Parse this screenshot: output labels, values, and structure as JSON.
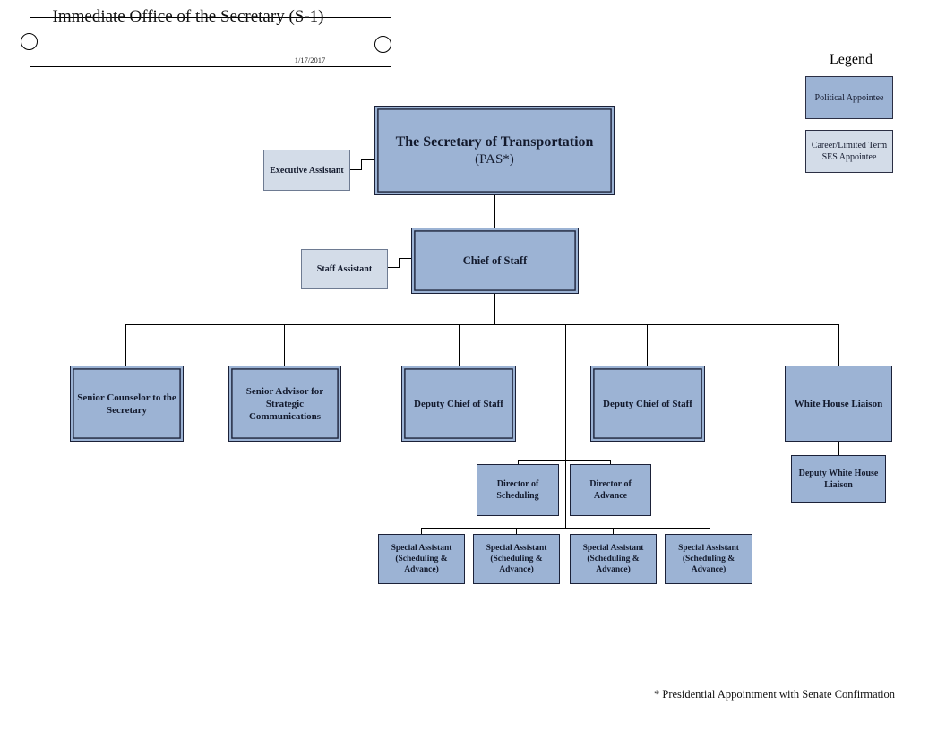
{
  "header": {
    "title": "Immediate Office of the Secretary (S-1)",
    "date": "1/17/2017"
  },
  "legend": {
    "title": "Legend",
    "items": [
      {
        "label": "Political Appointee",
        "color": "#9cb3d4",
        "type": "political"
      },
      {
        "label": "Career/Limited Term SES Appointee",
        "color": "#d3dce8",
        "type": "career"
      }
    ]
  },
  "nodes": {
    "secretary": {
      "title": "The Secretary of Transportation",
      "subtitle": "(PAS*)"
    },
    "executive_assistant": {
      "title": "Executive Assistant"
    },
    "chief_of_staff": {
      "title": "Chief of Staff"
    },
    "staff_assistant": {
      "title": "Staff Assistant"
    },
    "senior_counselor": {
      "title": "Senior Counselor to the Secretary"
    },
    "senior_advisor": {
      "title": "Senior Advisor for Strategic Communications"
    },
    "deputy_chief_1": {
      "title": "Deputy Chief of Staff"
    },
    "deputy_chief_2": {
      "title": "Deputy Chief of Staff"
    },
    "white_house_liaison": {
      "title": "White House Liaison"
    },
    "deputy_white_house_liaison": {
      "title": "Deputy White House Liaison"
    },
    "director_scheduling": {
      "title": "Director of Scheduling"
    },
    "director_advance": {
      "title": "Director of Advance"
    },
    "special_assistant_1": {
      "title": "Special Assistant (Scheduling & Advance)"
    },
    "special_assistant_2": {
      "title": "Special Assistant (Scheduling & Advance)"
    },
    "special_assistant_3": {
      "title": "Special Assistant (Scheduling & Advance)"
    },
    "special_assistant_4": {
      "title": "Special Assistant (Scheduling & Advance)"
    }
  },
  "footnote": "* Presidential Appointment with Senate Confirmation"
}
